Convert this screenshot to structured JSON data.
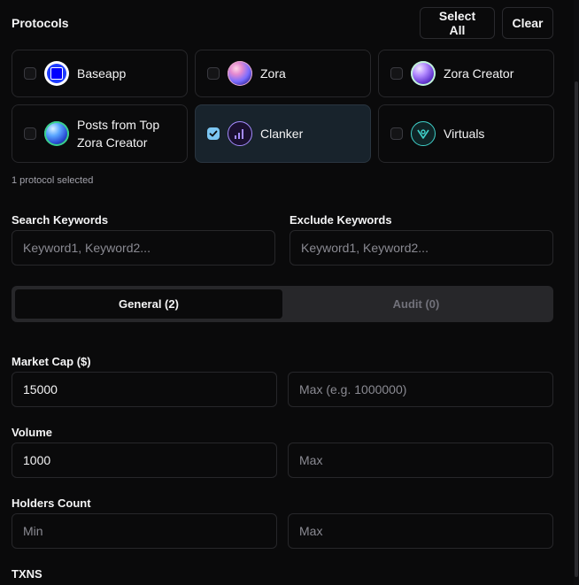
{
  "header": {
    "title": "Protocols",
    "select_all_label": "Select All",
    "clear_label": "Clear"
  },
  "protocols": [
    {
      "label": "Baseapp",
      "checked": false,
      "icon": "baseapp-logo-icon"
    },
    {
      "label": "Zora",
      "checked": false,
      "icon": "zora-logo-icon"
    },
    {
      "label": "Zora Creator",
      "checked": false,
      "icon": "zora-creator-logo-icon"
    },
    {
      "label_line1": "Posts from Top",
      "label_line2": "Zora Creator",
      "checked": false,
      "icon": "posts-logo-icon"
    },
    {
      "label": "Clanker",
      "checked": true,
      "icon": "clanker-logo-icon"
    },
    {
      "label": "Virtuals",
      "checked": false,
      "icon": "virtuals-logo-icon"
    }
  ],
  "selection_status": "1 protocol selected",
  "keywords": {
    "search_label": "Search Keywords",
    "search_placeholder": "Keyword1, Keyword2...",
    "exclude_label": "Exclude Keywords",
    "exclude_placeholder": "Keyword1, Keyword2..."
  },
  "tabs": [
    {
      "label": "General (2)",
      "active": true
    },
    {
      "label": "Audit (0)",
      "active": false
    }
  ],
  "filters": {
    "market_cap": {
      "label": "Market Cap ($)",
      "min_value": "15000",
      "max_placeholder": "Max (e.g. 1000000)"
    },
    "volume": {
      "label": "Volume",
      "min_value": "1000",
      "max_placeholder": "Max"
    },
    "holders": {
      "label": "Holders Count",
      "min_placeholder": "Min",
      "max_placeholder": "Max"
    },
    "txns": {
      "label": "TXNS"
    }
  },
  "colors": {
    "background": "#0a0a0b",
    "selected_card": "#18232c",
    "checkbox_checked": "#7cc6f2",
    "clanker_accent": "#a58bff",
    "virtuals_accent": "#3fd0c9"
  }
}
